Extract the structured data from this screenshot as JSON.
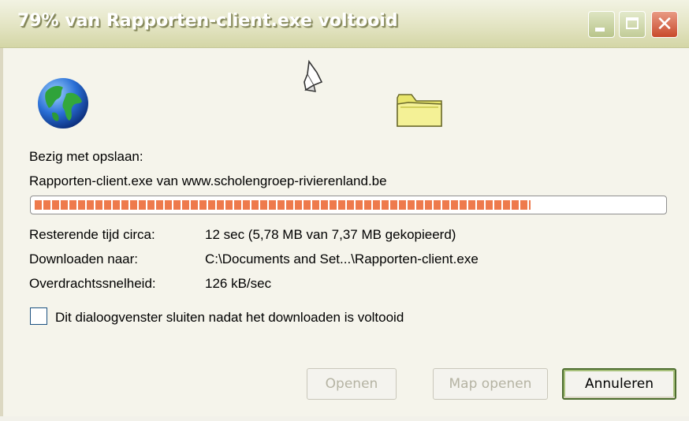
{
  "window": {
    "title": "79% van Rapporten-client.exe voltooid",
    "minimize_icon": "minimize-icon",
    "maximize_icon": "maximize-icon",
    "close_icon": "close-icon",
    "close_glyph": "✕"
  },
  "animation": {
    "source_icon": "globe-icon",
    "transfer_icon": "flying-document-icon",
    "destination_icon": "folder-icon"
  },
  "status": {
    "saving_label": "Bezig met opslaan:",
    "file_line": "Rapporten-client.exe van www.scholengroep-rivierenland.be",
    "progress_fraction": 0.79,
    "progress_color": "#ee7a4c"
  },
  "details": {
    "remaining_label": "Resterende tijd circa:",
    "remaining_value": "12 sec (5,78 MB van 7,37 MB gekopieerd)",
    "download_to_label": "Downloaden naar:",
    "download_to_value": "C:\\Documents and Set...\\Rapporten-client.exe",
    "rate_label": "Overdrachtssnelheid:",
    "rate_value": "126 kB/sec"
  },
  "options": {
    "close_when_done_label": "Dit dialoogvenster sluiten nadat het downloaden is voltooid",
    "close_when_done_checked": false
  },
  "buttons": {
    "open": "Openen",
    "open_folder": "Map openen",
    "cancel": "Annuleren"
  }
}
